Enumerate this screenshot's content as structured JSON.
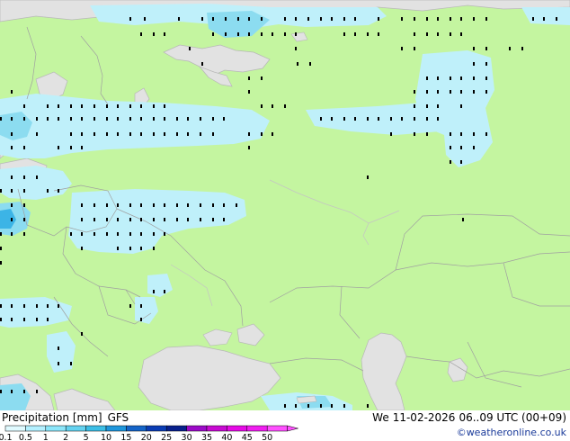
{
  "title": {
    "parameter": "Precipitation [mm]",
    "model": "GFS"
  },
  "valid_time": {
    "day": "We",
    "date": "11-02-2026",
    "time": "06..09 UTC (00+09)"
  },
  "credit": "©weatheronline.co.uk",
  "legend": {
    "labels": [
      "0.1",
      "0.5",
      "1",
      "2",
      "5",
      "10",
      "15",
      "20",
      "25",
      "30",
      "35",
      "40",
      "45",
      "50"
    ],
    "colors": [
      "#e0faff",
      "#b4f0ff",
      "#8ce6fa",
      "#64d2f0",
      "#3cbee6",
      "#1e96dc",
      "#1464c8",
      "#0a3cb4",
      "#08208c",
      "#9c0ac8",
      "#c80ad2",
      "#e60ae6",
      "#f01ef0",
      "#ff50ff"
    ]
  },
  "map_colors": {
    "land": "#c4f5a0",
    "sea": "#e2e2e2",
    "border": "#a0a0a0",
    "precip_light": "#bff0fa",
    "precip_medium": "#8cdcf0",
    "precip_heavy": "#3cb4e6"
  }
}
